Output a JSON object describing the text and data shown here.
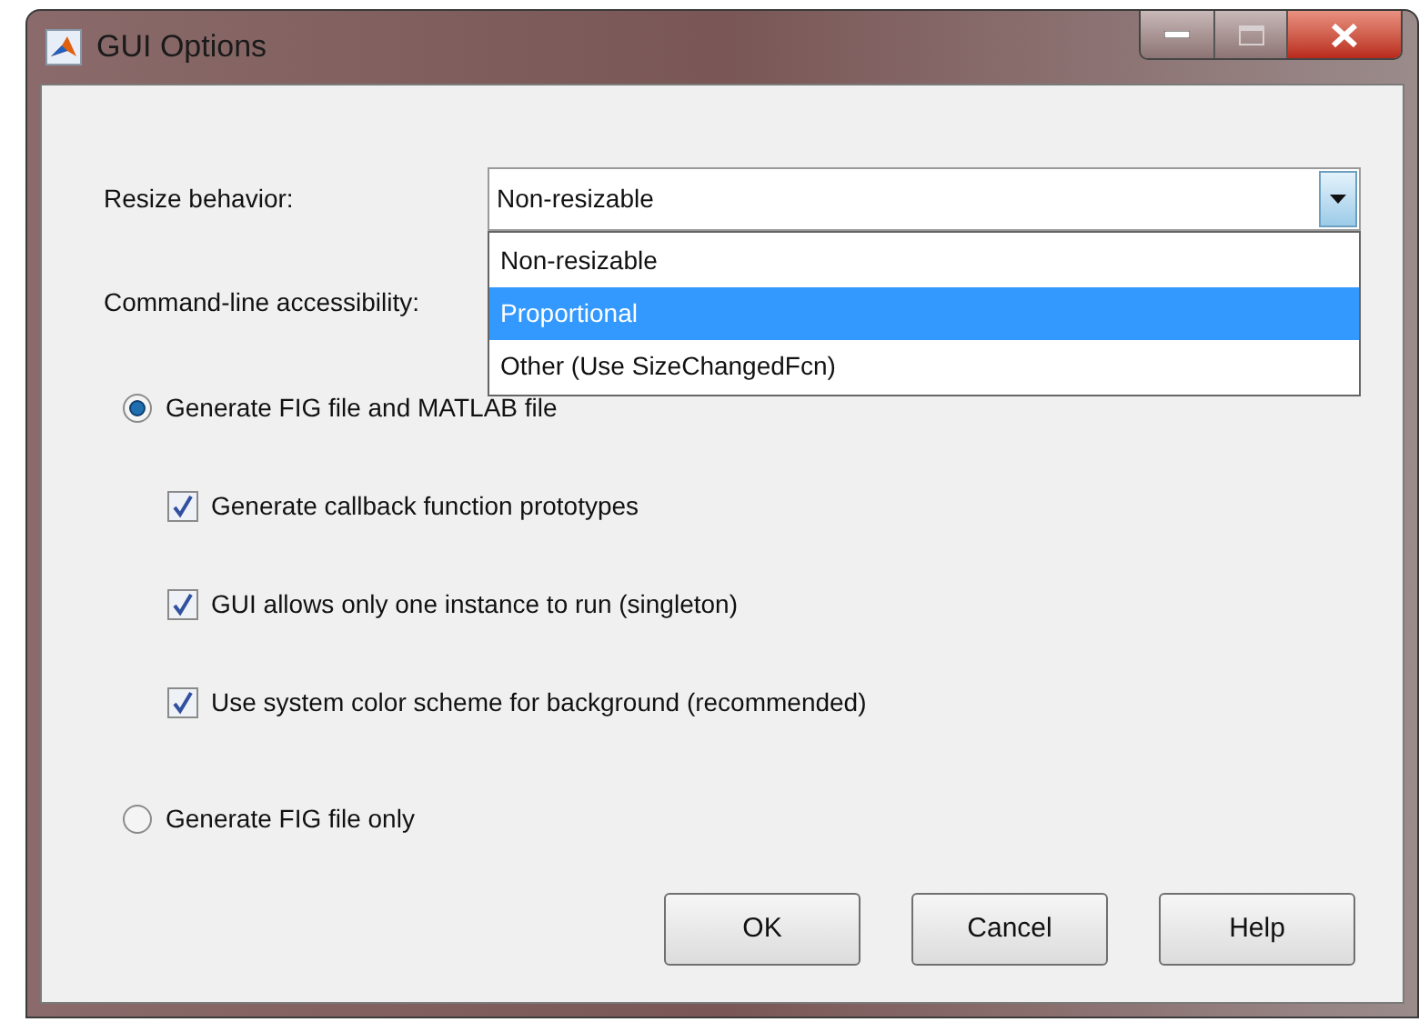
{
  "window": {
    "title": "GUI Options"
  },
  "resize_behavior": {
    "label": "Resize behavior:",
    "value": "Non-resizable",
    "expanded": true,
    "options": [
      {
        "label": "Non-resizable",
        "highlighted": false
      },
      {
        "label": "Proportional",
        "highlighted": true
      },
      {
        "label": "Other (Use SizeChangedFcn)",
        "highlighted": false
      }
    ]
  },
  "command_line_accessibility": {
    "label": "Command-line accessibility:"
  },
  "generate_options": [
    {
      "kind": "radio",
      "label": "Generate FIG file and MATLAB file",
      "selected": true
    },
    {
      "kind": "checkbox",
      "label": "Generate callback function prototypes",
      "checked": true
    },
    {
      "kind": "checkbox",
      "label": "GUI allows only one instance to run (singleton)",
      "checked": true
    },
    {
      "kind": "checkbox",
      "label": "Use system color scheme for background (recommended)",
      "checked": true
    },
    {
      "kind": "radio",
      "label": "Generate FIG file only",
      "selected": false
    }
  ],
  "buttons": [
    {
      "label": "OK"
    },
    {
      "label": "Cancel"
    },
    {
      "label": "Help"
    }
  ]
}
